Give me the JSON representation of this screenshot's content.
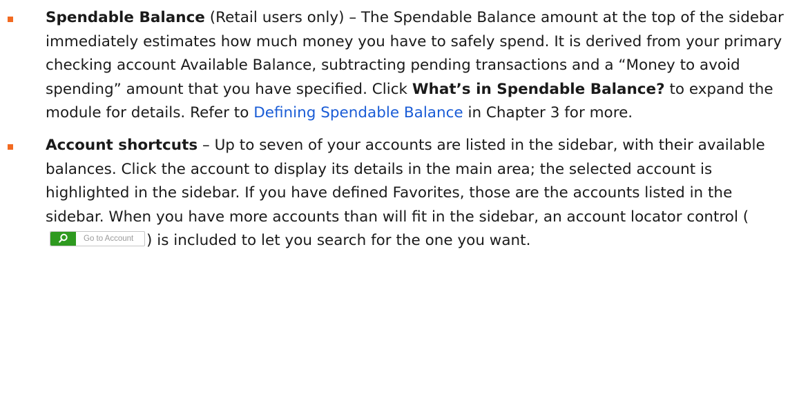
{
  "colors": {
    "bullet": "#f26a21",
    "link": "#1a5cd6",
    "locator_button": "#2e9a1f"
  },
  "items": [
    {
      "title": "Spendable Balance",
      "intro": " (Retail users only) – The Spendable Balance amount at the top of the sidebar immediately estimates how much money you have to safely spend. It is derived from your primary checking account Available Balance, subtracting pending transactions and a “Money to avoid spending” amount that you have specified. Click ",
      "bold_action": "What’s in Spendable Balance?",
      "after_action": " to expand the module for details. Refer to ",
      "link": "Defining Spendable Balance",
      "outro": " in Chapter 3 for more."
    },
    {
      "title": "Account shortcuts",
      "intro": " – Up to seven of your accounts are listed in the sidebar, with their available balances. Click the account to display its details in the main area; the selected account is highlighted in the sidebar. If you have defined Favorites, those are the accounts listed in the sidebar. When you have more accounts than will fit in the sidebar, an account locator control (",
      "locator": {
        "icon": "search-icon",
        "placeholder": "Go to Account"
      },
      "outro": ") is included to let you search for the one you want."
    }
  ]
}
